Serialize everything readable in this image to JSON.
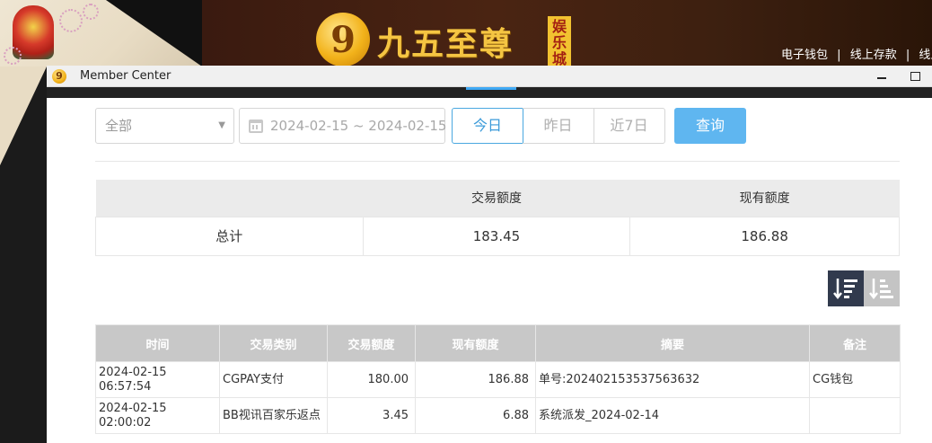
{
  "banner": {
    "logo_mark": "9",
    "logo_text": "九五至尊",
    "logo_tag": "娱乐城",
    "top_links": [
      "电子钱包",
      "|",
      "线上存款",
      "|",
      "线上"
    ]
  },
  "window": {
    "title": "Member Center",
    "icon_glyph": "9"
  },
  "filters": {
    "category_select": "全部",
    "date_range": "2024-02-15 ~ 2024-02-15",
    "quick_today": "今日",
    "quick_yesterday": "昨日",
    "quick_7days": "近7日",
    "query_button": "查询"
  },
  "summary": {
    "headers": [
      "",
      "交易额度",
      "现有额度"
    ],
    "row_label": "总计",
    "transaction_total": "183.45",
    "current_total": "186.88"
  },
  "detail": {
    "headers": [
      "时间",
      "交易类别",
      "交易额度",
      "现有额度",
      "摘要",
      "备注"
    ],
    "rows": [
      [
        "2024-02-15 06:57:54",
        "CGPAY支付",
        "180.00",
        "186.88",
        "单号:202402153537563632",
        "CG钱包"
      ],
      [
        "2024-02-15 02:00:02",
        "BB视讯百家乐返点",
        "3.45",
        "6.88",
        "系统派发_2024-02-14",
        ""
      ]
    ]
  },
  "colors": {
    "accent": "#3fa9f5",
    "query_button": "#5fb6f0",
    "sort_active": "#313a4d",
    "table_header": "#c8c8c8"
  }
}
